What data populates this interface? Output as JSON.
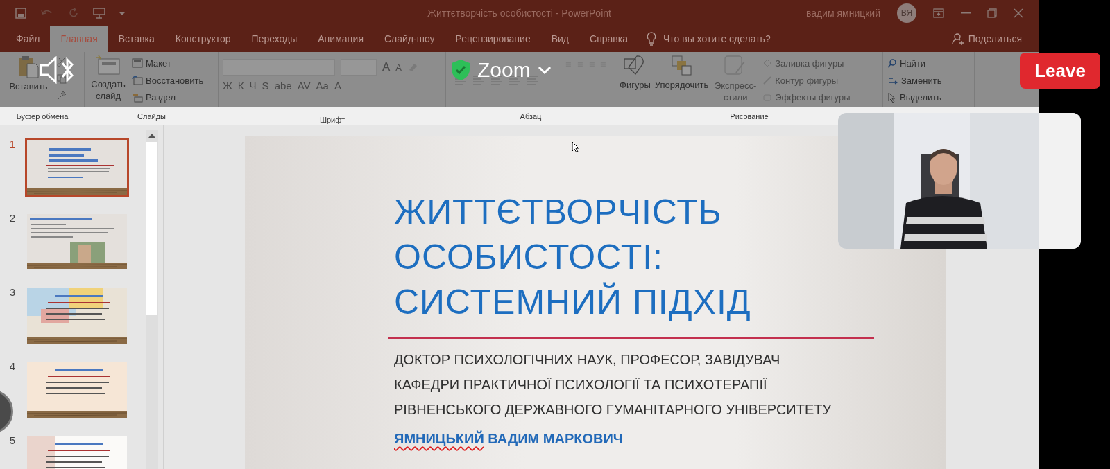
{
  "window": {
    "title": "Життєтворчість особистості  -  PowerPoint",
    "user": "вадим ямницкий",
    "avatar": "ВЯ"
  },
  "tabs": [
    {
      "label": "Файл",
      "selected": false
    },
    {
      "label": "Главная",
      "selected": true
    },
    {
      "label": "Вставка",
      "selected": false
    },
    {
      "label": "Конструктор",
      "selected": false
    },
    {
      "label": "Переходы",
      "selected": false
    },
    {
      "label": "Анимация",
      "selected": false
    },
    {
      "label": "Слайд-шоу",
      "selected": false
    },
    {
      "label": "Рецензирование",
      "selected": false
    },
    {
      "label": "Вид",
      "selected": false
    },
    {
      "label": "Справка",
      "selected": false
    }
  ],
  "tell_me": "Что вы хотите сделать?",
  "share": "Поделиться",
  "ribbon": {
    "clipboard": {
      "label": "Буфер обмена",
      "paste": "Вставить"
    },
    "slides": {
      "label": "Слайды",
      "new_slide": "Создать слайд",
      "layout": "Макет",
      "reset": "Восстановить",
      "section": "Раздел"
    },
    "font": {
      "label": "Шрифт",
      "grow": "A",
      "shrink": "A",
      "format_buttons": [
        "Ж",
        "К",
        "Ч",
        "S",
        "abe",
        "AV",
        "Aa",
        "A"
      ]
    },
    "paragraph": {
      "label": "Абзац"
    },
    "drawing": {
      "label": "Рисование",
      "shapes": "Фигуры",
      "arrange": "Упорядочить",
      "styles": "Экспресс-стили",
      "fill": "Заливка фигуры",
      "outline": "Контур фигуры",
      "effects": "Эффекты фигуры"
    },
    "editing": {
      "find": "Найти",
      "replace": "Заменить",
      "select": "Выделить"
    }
  },
  "zoom": {
    "title": "Zoom",
    "leave": "Leave"
  },
  "thumbnails": [
    {
      "number": "1",
      "selected": true
    },
    {
      "number": "2",
      "selected": false
    },
    {
      "number": "3",
      "selected": false
    },
    {
      "number": "4",
      "selected": false
    },
    {
      "number": "5",
      "selected": false
    }
  ],
  "slide": {
    "title_lines": [
      "ЖИТТЄТВОРЧІСТЬ",
      "ОСОБИСТОСТІ:",
      "СИСТЕМНИЙ ПІДХІД"
    ],
    "subtitle_lines": [
      "ДОКТОР ПСИХОЛОГІЧНИХ НАУК, ПРОФЕСОР, ЗАВІДУВАЧ",
      "КАФЕДРИ ПРАКТИЧНОЇ ПСИХОЛОГІЇ ТА ПСИХОТЕРАПІЇ",
      "РІВНЕНСЬКОГО ДЕРЖАВНОГО ГУМАНІТАРНОГО УНІВЕРСИТЕТУ"
    ],
    "author_surname": "ЯМНИЦЬКИЙ",
    "author_names": "ВАДИМ МАРКОВИЧ",
    "spelling_error": true
  }
}
